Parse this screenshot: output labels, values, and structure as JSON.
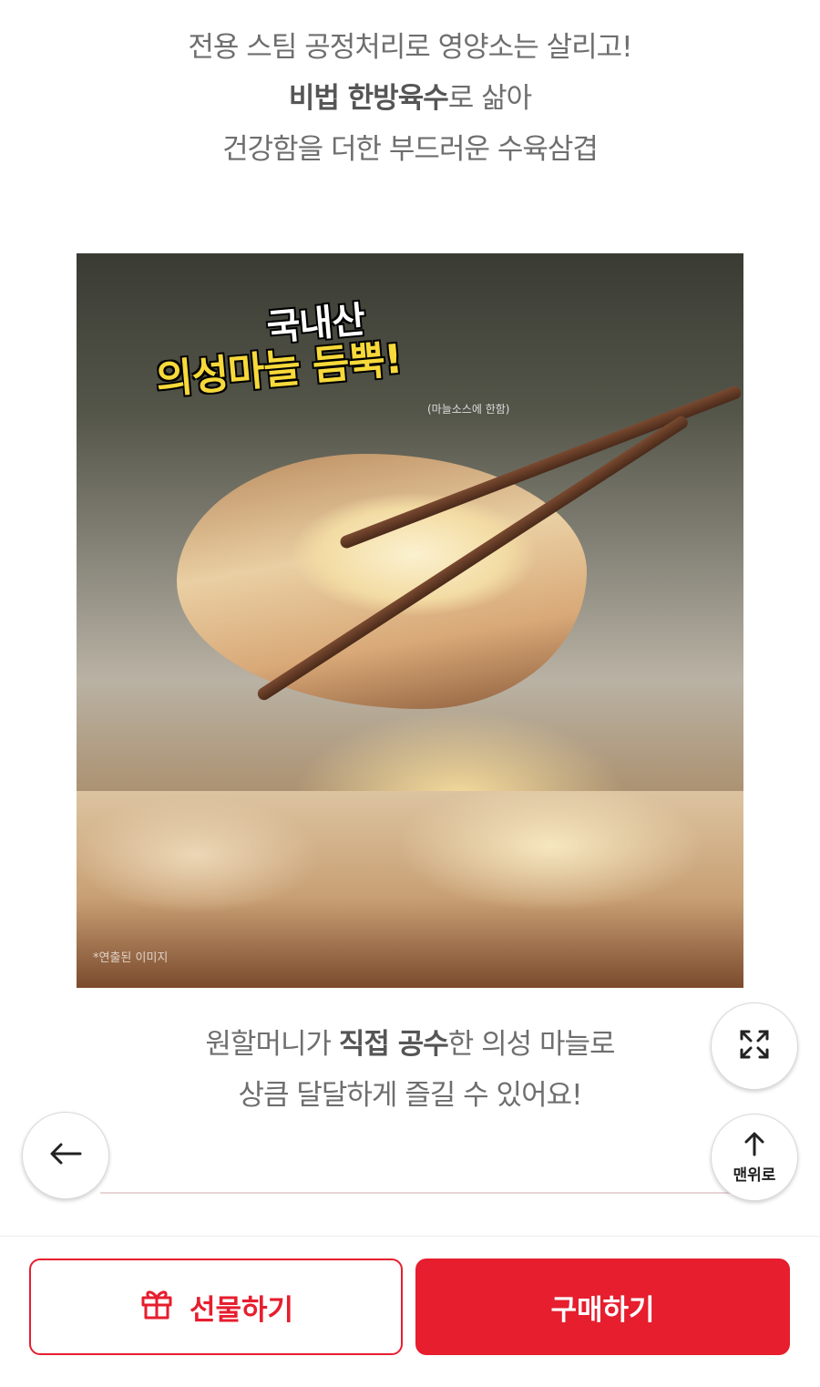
{
  "intro": {
    "line1": "전용 스팀 공정처리로 영양소는 살리고!",
    "line2_strong": "비법 한방육수",
    "line2_rest": "로 삶아",
    "line3": "건강함을 더한 부드러운 수육삼겹"
  },
  "photo": {
    "badge_line1": "국내산",
    "badge_line2": "의성마늘 듬뿍!",
    "badge_note": "(마늘소스에 한함)",
    "caption": "*연출된 이미지"
  },
  "description": {
    "line1_prefix": "원할머니가 ",
    "line1_strong": "직접 공수",
    "line1_suffix": "한 의성 마늘로",
    "line2": "상큼 달달하게 즐길 수 있어요!"
  },
  "floating": {
    "expand_icon": "expand-icon",
    "back_icon": "arrow-left-icon",
    "top_icon": "arrow-up-icon",
    "top_label": "맨위로"
  },
  "actions": {
    "gift_label": "선물하기",
    "gift_icon": "gift-icon",
    "buy_label": "구매하기",
    "accent_color": "#e61e2e"
  }
}
